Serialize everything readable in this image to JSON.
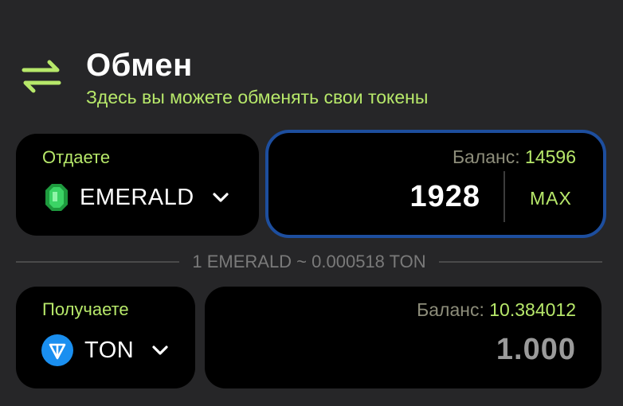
{
  "header": {
    "title": "Обмен",
    "subtitle": "Здесь вы можете обменять свои токены",
    "icon": "swap-arrows-icon",
    "accent_color": "#b7e86a"
  },
  "give": {
    "label": "Отдаете",
    "token": {
      "name": "EMERALD",
      "icon": "emerald-gem-icon"
    },
    "balance_label": "Баланс:",
    "balance_value": "14596",
    "amount": "1928",
    "max_label": "MAX",
    "focus_border_color": "#1d4e9e"
  },
  "rate": {
    "text": "1 EMERALD ~ 0.000518 TON"
  },
  "get": {
    "label": "Получаете",
    "token": {
      "name": "TON",
      "icon": "ton-logo-icon"
    },
    "balance_label": "Баланс:",
    "balance_value": "10.384012",
    "amount": "1.000"
  }
}
